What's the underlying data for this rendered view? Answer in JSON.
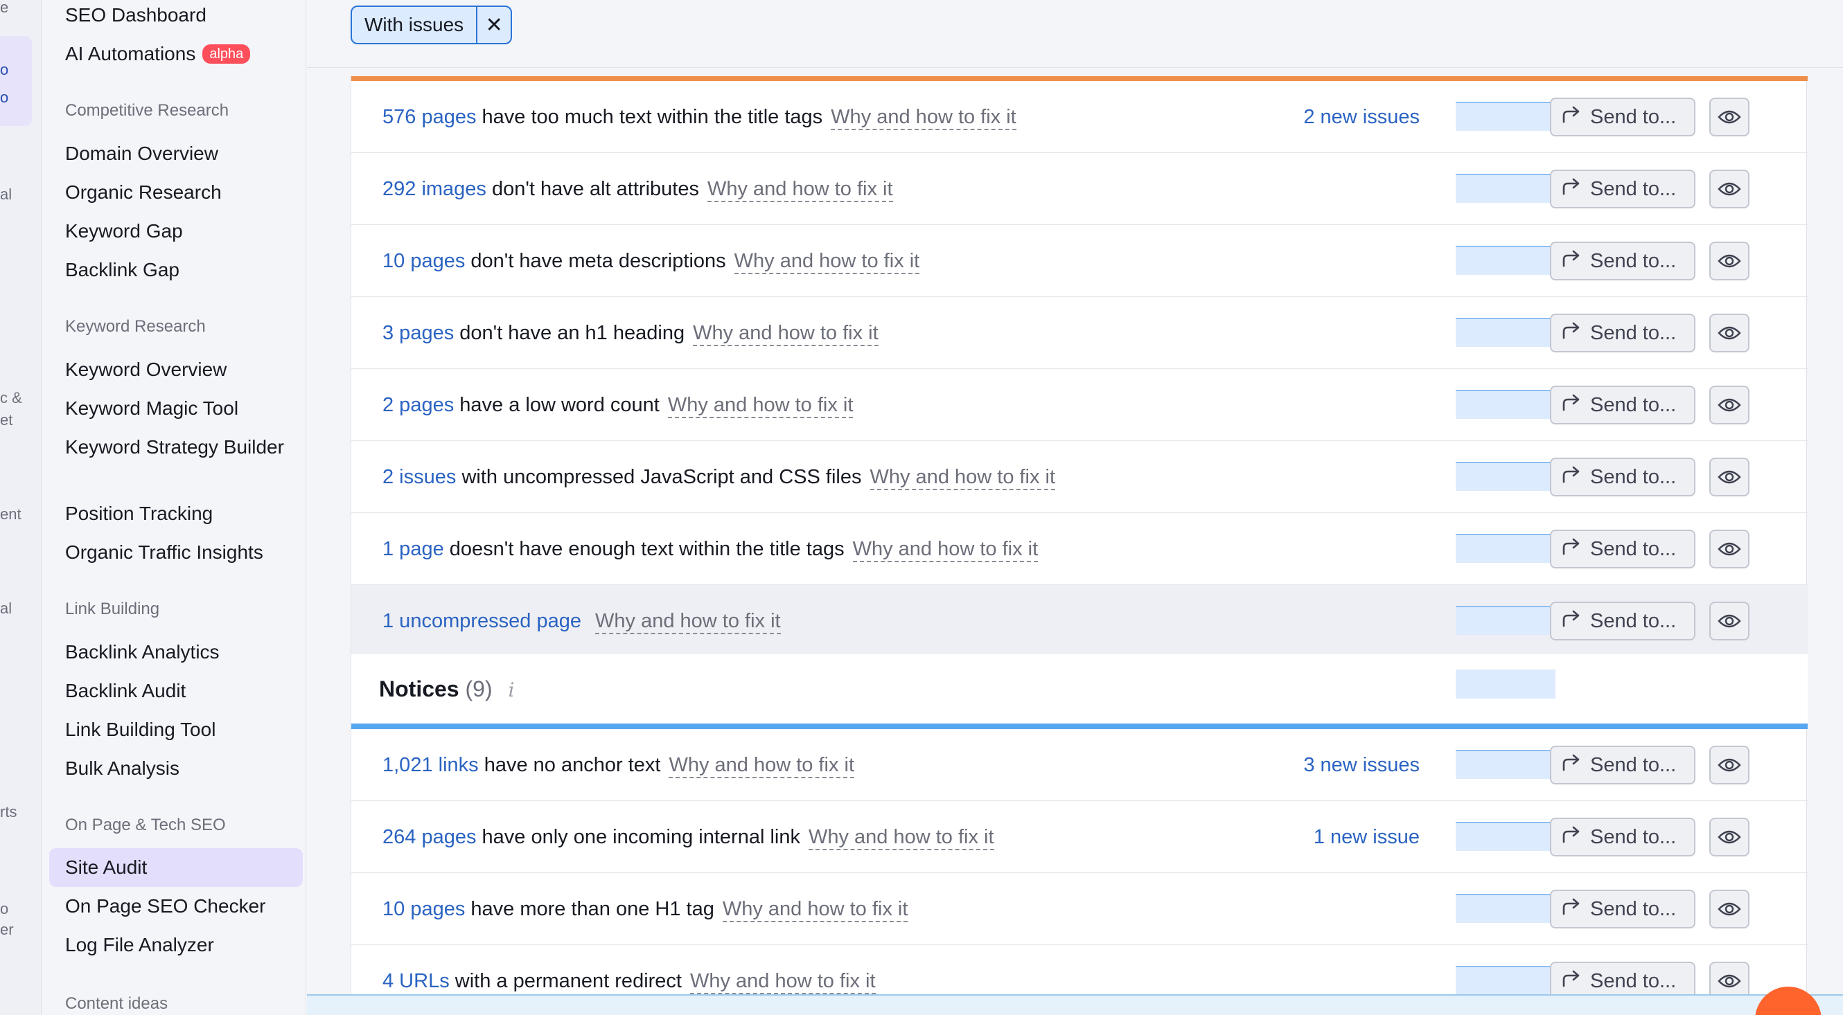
{
  "rail": {
    "fragments": [
      "e",
      "o",
      "o",
      "al",
      "c &",
      "et",
      "ent",
      "al",
      "rts",
      "o",
      "er"
    ]
  },
  "sidebar": {
    "top_items": [
      {
        "label": "SEO Dashboard"
      },
      {
        "label": "AI Automations",
        "badge": "alpha"
      }
    ],
    "sections": [
      {
        "heading": "Competitive Research",
        "items": [
          "Domain Overview",
          "Organic Research",
          "Keyword Gap",
          "Backlink Gap"
        ]
      },
      {
        "heading": "Keyword Research",
        "items": [
          "Keyword Overview",
          "Keyword Magic Tool",
          "Keyword Strategy Builder",
          "Position Tracking",
          "Organic Traffic Insights"
        ]
      },
      {
        "heading": "Link Building",
        "items": [
          "Backlink Analytics",
          "Backlink Audit",
          "Link Building Tool",
          "Bulk Analysis"
        ]
      },
      {
        "heading": "On Page & Tech SEO",
        "items": [
          "Site Audit",
          "On Page SEO Checker",
          "Log File Analyzer"
        ]
      },
      {
        "heading": "Content ideas",
        "items": []
      }
    ],
    "active_item": "Site Audit"
  },
  "filter": {
    "chip_label": "With issues",
    "chip_close": "✕"
  },
  "warnings": [
    {
      "count": "576 pages",
      "text": "have too much text within the title tags",
      "why": "Why and how to fix it",
      "new_issues": "2 new issues",
      "send": "Send to..."
    },
    {
      "count": "292 images",
      "text": "don't have alt attributes",
      "why": "Why and how to fix it",
      "new_issues": "",
      "send": "Send to..."
    },
    {
      "count": "10 pages",
      "text": "don't have meta descriptions",
      "why": "Why and how to fix it",
      "new_issues": "",
      "send": "Send to..."
    },
    {
      "count": "3 pages",
      "text": "don't have an h1 heading",
      "why": "Why and how to fix it",
      "new_issues": "",
      "send": "Send to..."
    },
    {
      "count": "2 pages",
      "text": "have a low word count",
      "why": "Why and how to fix it",
      "new_issues": "",
      "send": "Send to..."
    },
    {
      "count": "2 issues",
      "text": "with uncompressed JavaScript and CSS files",
      "why": "Why and how to fix it",
      "new_issues": "",
      "send": "Send to..."
    },
    {
      "count": "1 page",
      "text": "doesn't have enough text within the title tags",
      "why": "Why and how to fix it",
      "new_issues": "",
      "send": "Send to..."
    },
    {
      "count": "1 uncompressed page",
      "text": "",
      "why": "Why and how to fix it",
      "new_issues": "",
      "send": "Send to..."
    }
  ],
  "notices_header": {
    "title": "Notices",
    "count": "(9)",
    "info": "i"
  },
  "notices": [
    {
      "count": "1,021 links",
      "text": "have no anchor text",
      "why": "Why and how to fix it",
      "new_issues": "3 new issues",
      "send": "Send to..."
    },
    {
      "count": "264 pages",
      "text": "have only one incoming internal link",
      "why": "Why and how to fix it",
      "new_issues": "1 new issue",
      "send": "Send to..."
    },
    {
      "count": "10 pages",
      "text": "have more than one H1 tag",
      "why": "Why and how to fix it",
      "new_issues": "",
      "send": "Send to..."
    },
    {
      "count": "4 URLs",
      "text": "with a permanent redirect",
      "why": "Why and how to fix it",
      "new_issues": "",
      "send": "Send to..."
    }
  ],
  "colors": {
    "accent_link": "#2a63c2",
    "warning_bar": "#ef8f4d",
    "notice_bar": "#57a6f0",
    "alpha_badge": "#ff4f5a",
    "help_fab": "#ff642d"
  },
  "icons": {
    "send": "share-arrow-icon",
    "view": "eye-icon",
    "info": "info-icon",
    "close": "close-icon"
  }
}
